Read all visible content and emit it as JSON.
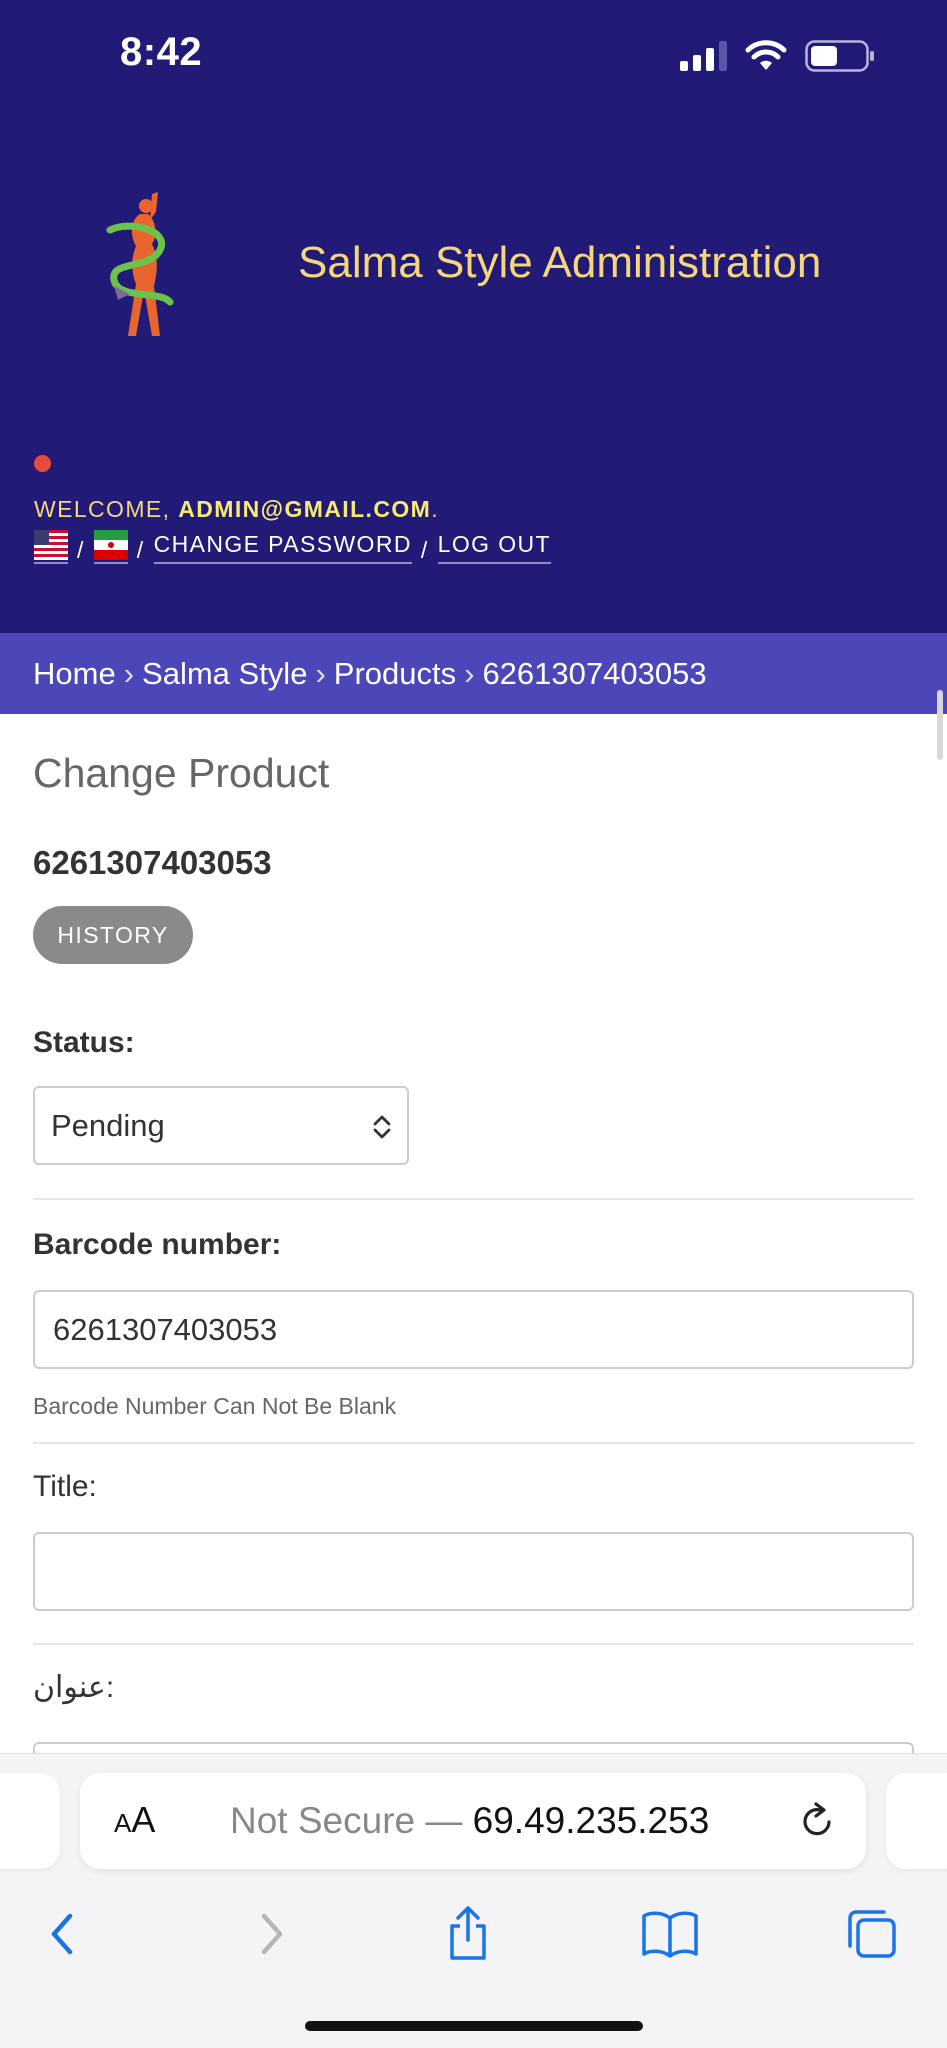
{
  "status_bar": {
    "time": "8:42"
  },
  "header": {
    "site_title": "Salma Style Administration",
    "welcome_prefix": "WELCOME,",
    "user_email": "ADMIN@GMAIL.COM",
    "welcome_suffix": ".",
    "separator": "/",
    "change_password": "CHANGE PASSWORD",
    "log_out": "LOG OUT"
  },
  "breadcrumbs": {
    "items": [
      "Home",
      "Salma Style",
      "Products",
      "6261307403053"
    ],
    "separator": "›"
  },
  "main": {
    "page_title": "Change Product",
    "object_title": "6261307403053",
    "history_button": "HISTORY",
    "fields": {
      "status": {
        "label": "Status:",
        "value": "Pending"
      },
      "barcode": {
        "label": "Barcode number:",
        "value": "6261307403053",
        "help": "Barcode Number Can Not Be Blank"
      },
      "title": {
        "label": "Title:",
        "value": ""
      },
      "title_fa": {
        "label": "عنوان:",
        "value": ""
      }
    }
  },
  "browser": {
    "aa_label_small": "A",
    "aa_label_large": "A",
    "url_prefix": "Not Secure — ",
    "url_host": "69.49.235.253"
  },
  "colors": {
    "header_bg": "#211a77",
    "breadcrumb_bg": "#4c46b8",
    "accent_yellow": "#f5d67b",
    "history_button": "#8a8a8a",
    "browser_blue": "#1a73e8"
  },
  "icons": [
    "signal-icon",
    "wifi-icon",
    "battery-icon",
    "logo-icon",
    "us-flag-icon",
    "iran-flag-icon",
    "select-arrows-icon",
    "reload-icon",
    "back-icon",
    "forward-icon",
    "share-icon",
    "bookmarks-icon",
    "tabs-icon"
  ]
}
